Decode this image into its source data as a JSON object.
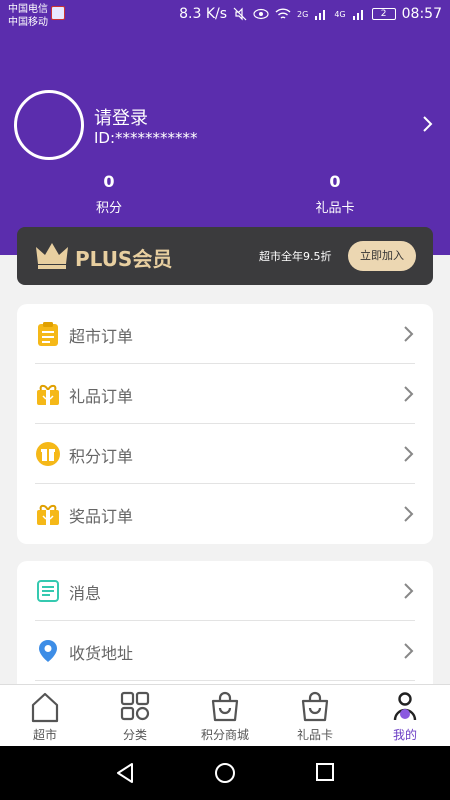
{
  "status_bar": {
    "carrier1": "中国电信",
    "carrier2": "中国移动",
    "speed": "8.3 K/s",
    "net1": "2G",
    "net2": "4G",
    "battery": "2",
    "time": "08:57"
  },
  "profile": {
    "login_prompt": "请登录",
    "user_id": "ID:***********"
  },
  "stats": [
    {
      "value": "0",
      "label": "积分"
    },
    {
      "value": "0",
      "label": "礼品卡"
    }
  ],
  "plus": {
    "title": "PLUS会员",
    "promo": "超市全年9.5折",
    "join_label": "立即加入"
  },
  "order_menu": [
    {
      "label": "超市订单",
      "icon": "clipboard-icon"
    },
    {
      "label": "礼品订单",
      "icon": "gift-box-icon"
    },
    {
      "label": "积分订单",
      "icon": "gift-icon"
    },
    {
      "label": "奖品订单",
      "icon": "prize-box-icon"
    }
  ],
  "other_menu": [
    {
      "label": "消息",
      "icon": "message-icon"
    },
    {
      "label": "收货地址",
      "icon": "location-icon"
    }
  ],
  "bottom_nav": [
    {
      "label": "超市",
      "icon": "home-icon"
    },
    {
      "label": "分类",
      "icon": "category-icon"
    },
    {
      "label": "积分商城",
      "icon": "shopping-bag-icon"
    },
    {
      "label": "礼品卡",
      "icon": "shopping-bag-icon"
    },
    {
      "label": "我的",
      "icon": "profile-icon",
      "active": true
    }
  ],
  "colors": {
    "brand_purple": "#5b2dad",
    "active_tab": "#6a3cc4",
    "gold": "#e8cfa0",
    "order_icon_yellow": "#f5b818"
  }
}
